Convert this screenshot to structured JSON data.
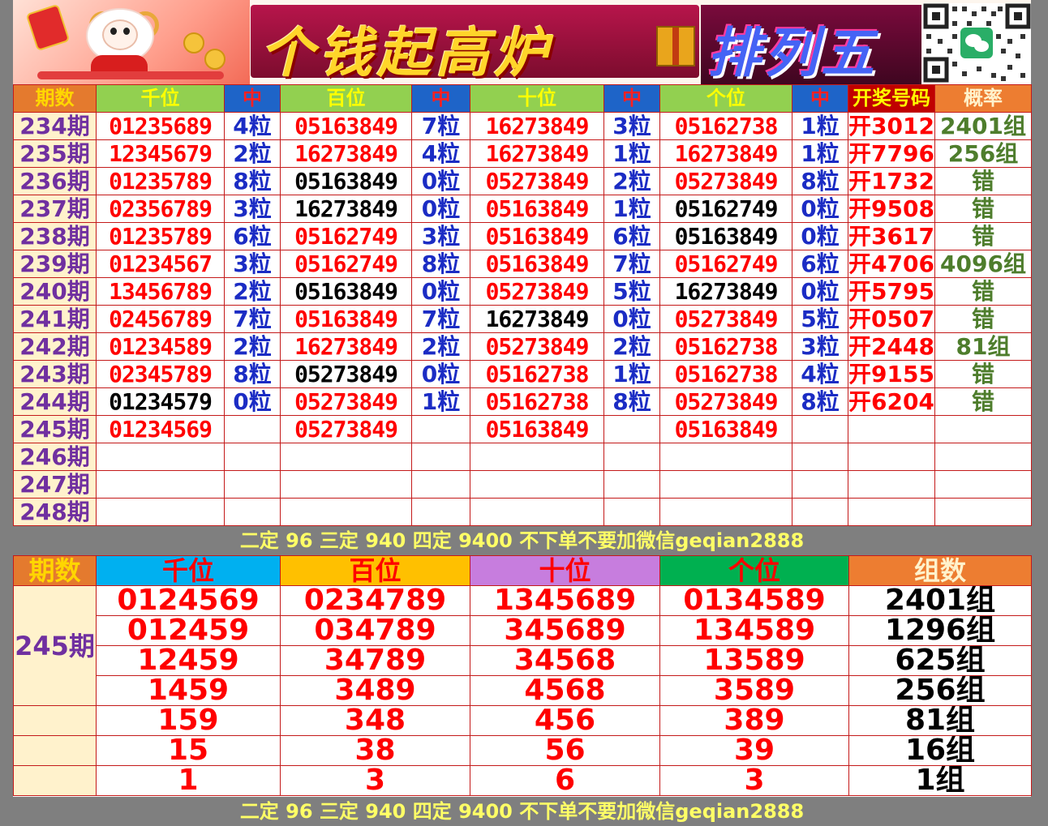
{
  "banner": {
    "title": "个钱起高炉",
    "subtitle": "排列五",
    "qr_label": "wechat-qr"
  },
  "table1": {
    "headers": [
      "期数",
      "千位",
      "中",
      "百位",
      "中",
      "十位",
      "中",
      "个位",
      "中",
      "开奖号码",
      "概率"
    ],
    "rows": [
      {
        "issue": "234期",
        "q": "01235689",
        "qm": "4粒",
        "b": "05163849",
        "bm": "7粒",
        "s": "16273849",
        "sm": "3粒",
        "g": "05162738",
        "gm": "1粒",
        "open": "开3012",
        "rate": "2401组"
      },
      {
        "issue": "235期",
        "q": "12345679",
        "qm": "2粒",
        "b": "16273849",
        "bm": "4粒",
        "s": "16273849",
        "sm": "1粒",
        "g": "16273849",
        "gm": "1粒",
        "open": "开7796",
        "rate": "256组"
      },
      {
        "issue": "236期",
        "q": "01235789",
        "qm": "8粒",
        "b": "05163849",
        "bm": "0粒",
        "s": "05273849",
        "sm": "2粒",
        "g": "05273849",
        "gm": "8粒",
        "open": "开1732",
        "rate": "错"
      },
      {
        "issue": "237期",
        "q": "02356789",
        "qm": "3粒",
        "b": "16273849",
        "bm": "0粒",
        "s": "05163849",
        "sm": "1粒",
        "g": "05162749",
        "gm": "0粒",
        "open": "开9508",
        "rate": "错"
      },
      {
        "issue": "238期",
        "q": "01235789",
        "qm": "6粒",
        "b": "05162749",
        "bm": "3粒",
        "s": "05163849",
        "sm": "6粒",
        "g": "05163849",
        "gm": "0粒",
        "open": "开3617",
        "rate": "错"
      },
      {
        "issue": "239期",
        "q": "01234567",
        "qm": "3粒",
        "b": "05162749",
        "bm": "8粒",
        "s": "05163849",
        "sm": "7粒",
        "g": "05162749",
        "gm": "6粒",
        "open": "开4706",
        "rate": "4096组"
      },
      {
        "issue": "240期",
        "q": "13456789",
        "qm": "2粒",
        "b": "05163849",
        "bm": "0粒",
        "s": "05273849",
        "sm": "5粒",
        "g": "16273849",
        "gm": "0粒",
        "open": "开5795",
        "rate": "错"
      },
      {
        "issue": "241期",
        "q": "02456789",
        "qm": "7粒",
        "b": "05163849",
        "bm": "7粒",
        "s": "16273849",
        "sm": "0粒",
        "g": "05273849",
        "gm": "5粒",
        "open": "开0507",
        "rate": "错"
      },
      {
        "issue": "242期",
        "q": "01234589",
        "qm": "2粒",
        "b": "16273849",
        "bm": "2粒",
        "s": "05273849",
        "sm": "2粒",
        "g": "05162738",
        "gm": "3粒",
        "open": "开2448",
        "rate": "81组"
      },
      {
        "issue": "243期",
        "q": "02345789",
        "qm": "8粒",
        "b": "05273849",
        "bm": "0粒",
        "s": "05162738",
        "sm": "1粒",
        "g": "05162738",
        "gm": "4粒",
        "open": "开9155",
        "rate": "错"
      },
      {
        "issue": "244期",
        "q": "01234579",
        "qm": "0粒",
        "b": "05273849",
        "bm": "1粒",
        "s": "05162738",
        "sm": "8粒",
        "g": "05273849",
        "gm": "8粒",
        "open": "开6204",
        "rate": "错"
      },
      {
        "issue": "245期",
        "q": "01234569",
        "qm": "",
        "b": "05273849",
        "bm": "",
        "s": "05163849",
        "sm": "",
        "g": "05163849",
        "gm": "",
        "open": "",
        "rate": ""
      },
      {
        "issue": "246期",
        "q": "",
        "qm": "",
        "b": "",
        "bm": "",
        "s": "",
        "sm": "",
        "g": "",
        "gm": "",
        "open": "",
        "rate": ""
      },
      {
        "issue": "247期",
        "q": "",
        "qm": "",
        "b": "",
        "bm": "",
        "s": "",
        "sm": "",
        "g": "",
        "gm": "",
        "open": "",
        "rate": ""
      },
      {
        "issue": "248期",
        "q": "",
        "qm": "",
        "b": "",
        "bm": "",
        "s": "",
        "sm": "",
        "g": "",
        "gm": "",
        "open": "",
        "rate": ""
      }
    ]
  },
  "notice": "二定 96 三定 940 四定 9400 不下单不要加微信geqian2888",
  "table2": {
    "headers": [
      "期数",
      "千位",
      "百位",
      "十位",
      "个位",
      "组数"
    ],
    "issue": "245期",
    "rows": [
      {
        "q": "0124569",
        "b": "0234789",
        "s": "1345689",
        "g": "0134589",
        "z": "2401组"
      },
      {
        "q": "012459",
        "b": "034789",
        "s": "345689",
        "g": "134589",
        "z": "1296组"
      },
      {
        "q": "12459",
        "b": "34789",
        "s": "34568",
        "g": "13589",
        "z": "625组"
      },
      {
        "q": "1459",
        "b": "3489",
        "s": "4568",
        "g": "3589",
        "z": "256组"
      },
      {
        "q": "159",
        "b": "348",
        "s": "456",
        "g": "389",
        "z": "81组"
      },
      {
        "q": "15",
        "b": "38",
        "s": "56",
        "g": "39",
        "z": "16组"
      },
      {
        "q": "1",
        "b": "3",
        "s": "6",
        "g": "3",
        "z": "1组"
      }
    ]
  },
  "colors": {
    "red_numbers": "#ff0000",
    "black_numbers": "#000000",
    "issue_purple": "#7030a0",
    "hit_count_blue": "#1b2cc4",
    "rate_green": "#4e7d2c"
  }
}
